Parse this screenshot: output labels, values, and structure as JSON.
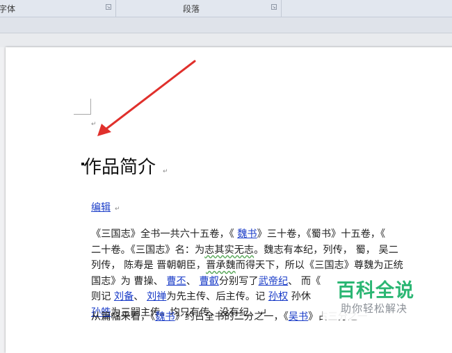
{
  "ribbon": {
    "groups": [
      {
        "label": "字体"
      },
      {
        "label": "段落"
      }
    ]
  },
  "document": {
    "paragraph_mark": "↵",
    "heading": "作品简介",
    "edit_link": "编辑",
    "para1": [
      [
        "《三国志》全书一共六十五卷，《 ",
        {
          "link": "魏书"
        },
        "》三十卷，《蜀书》十五卷，《"
      ],
      [
        "二十卷。《三国志》名：为",
        {
          "wavy": "志其实无志"
        },
        "。魏志有本纪，列传，  蜀，  吴二"
      ],
      [
        "列传，  陈寿是 晋朝朝臣，",
        {
          "wavy": "晋承魏"
        },
        "而得天下，所以《三国志》尊魏为正统"
      ],
      [
        "国志》为 曹操、 ",
        {
          "link": "曹丕"
        },
        "、 ",
        {
          "link": "曹叡"
        },
        "分别写了",
        {
          "link": "武帝纪"
        },
        "、             而《"
      ],
      [
        "则记 ",
        {
          "link": "刘备"
        },
        "、 ",
        {
          "link": "刘禅"
        },
        "为先主传、后主传。记 ",
        {
          "link": "孙权"
        },
        "                孙休"
      ],
      [
        {
          "link": "孙皓"
        },
        "为三嗣主传。均只有传，没有纪。↵"
      ]
    ],
    "para2": [
      "从篇幅来看，《",
      {
        "link": "魏书"
      },
      "》约占全书的二分之一，《",
      {
        "link": "吴书"
      },
      "》占三分之一"
    ]
  },
  "watermark": {
    "title": "百科全说",
    "subtitle": "助你轻松解决"
  },
  "colors": {
    "link": "#1a3cc8",
    "arrow": "#e0302c",
    "watermark": "#2bb673"
  }
}
